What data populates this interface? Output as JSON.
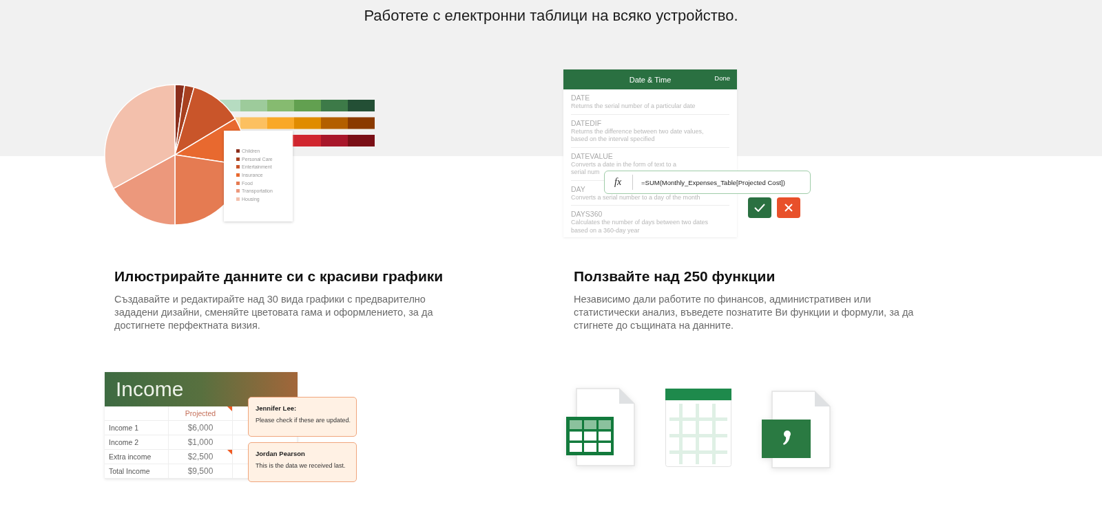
{
  "page_title": "Работете с електронни таблици на всяко устройство.",
  "chart_illustration": {
    "legend": [
      {
        "label": "Children",
        "color": "#8b2e1c"
      },
      {
        "label": "Personal Care",
        "color": "#a8401f"
      },
      {
        "label": "Entertainment",
        "color": "#c9552a"
      },
      {
        "label": "Insurance",
        "color": "#e8692f"
      },
      {
        "label": "Food",
        "color": "#e57b52"
      },
      {
        "label": "Transportation",
        "color": "#ec987c"
      },
      {
        "label": "Housing",
        "color": "#f3c0ac"
      }
    ]
  },
  "functions_illustration": {
    "header": {
      "title": "Date & Time",
      "action": "Done"
    },
    "functions": [
      {
        "name": "DATE",
        "description_lines": [
          "Returns the serial number of a particular date"
        ]
      },
      {
        "name": "DATEDIF",
        "description_lines": [
          "Returns the difference between two date values,",
          "based on the interval specified"
        ]
      },
      {
        "name": "DATEVALUE",
        "description_lines": [
          "Converts a date in the form of text to a",
          "serial num"
        ]
      },
      {
        "name": "DAY",
        "description_lines": [
          "Converts a serial number to a day of the month"
        ]
      },
      {
        "name": "DAYS360",
        "description_lines": [
          "Calculates the number of days between two dates",
          "based on a 360-day year"
        ]
      }
    ],
    "formula": {
      "label": "fx",
      "value": "=SUM(Monthly_Expenses_Table[Projected Cost])"
    }
  },
  "features": [
    {
      "title": "Илюстрирайте данните си с красиви графики",
      "description": "Създавайте и редактирайте над 30 вида графики с предварително зададени дизайни, сменяйте цветовата гама и оформлението, за да достигнете перфектната визия."
    },
    {
      "title": "Ползвайте над 250 функции",
      "description": "Независимо дали работите по финансов, административен или статистически анализ, въведете познатите Ви функции и формули, за да стигнете до същината на данните."
    }
  ],
  "income_illustration": {
    "title": "Income",
    "column_header": "Projected",
    "header_commented": true,
    "rows": [
      {
        "label": "Income 1",
        "value": "$6,000",
        "commented": false
      },
      {
        "label": "Income 2",
        "value": "$1,000",
        "commented": false
      },
      {
        "label": "Extra income",
        "value": "$2,500",
        "commented": true
      },
      {
        "label": "Total Income",
        "value": "$9,500",
        "commented": false
      }
    ],
    "comments": [
      {
        "author": "Jennifer Lee:",
        "text": "Please check if these are updated."
      },
      {
        "author": "Jordan Pearson",
        "text": "This is the data we received last."
      }
    ]
  }
}
